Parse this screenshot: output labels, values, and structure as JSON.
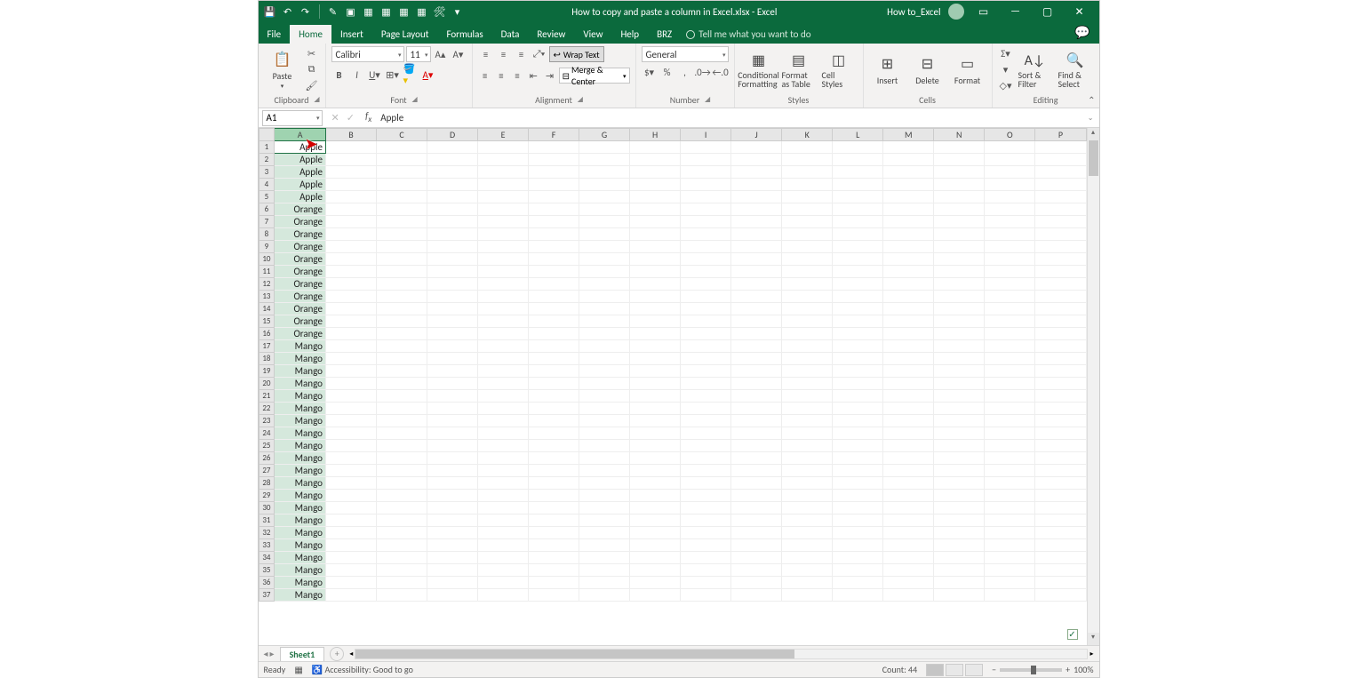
{
  "title": "How to copy and paste a column in Excel.xlsx - Excel",
  "user": "How to_Excel",
  "tabs": [
    "File",
    "Home",
    "Insert",
    "Page Layout",
    "Formulas",
    "Data",
    "Review",
    "View",
    "Help",
    "BRZ"
  ],
  "active_tab": 1,
  "tell_me": "Tell me what you want to do",
  "font": {
    "name": "Calibri",
    "size": "11"
  },
  "groups": {
    "clipboard": "Clipboard",
    "font": "Font",
    "alignment": "Alignment",
    "number": "Number",
    "styles": "Styles",
    "cells": "Cells",
    "editing": "Editing"
  },
  "paste": "Paste",
  "wrap": "Wrap Text",
  "merge": "Merge & Center",
  "numfmt": "General",
  "cond": "Conditional Formatting",
  "fmtas": "Format as Table",
  "cellst": "Cell Styles",
  "ins": "Insert",
  "del": "Delete",
  "fmt": "Format",
  "sort": "Sort & Filter",
  "find": "Find & Select",
  "namebox": "A1",
  "formula": "Apple",
  "cols": [
    "A",
    "B",
    "C",
    "D",
    "E",
    "F",
    "G",
    "H",
    "I",
    "J",
    "K",
    "L",
    "M",
    "N",
    "O",
    "P"
  ],
  "colA_data": [
    "Apple",
    "Apple",
    "Apple",
    "Apple",
    "Apple",
    "Orange",
    "Orange",
    "Orange",
    "Orange",
    "Orange",
    "Orange",
    "Orange",
    "Orange",
    "Orange",
    "Orange",
    "Orange",
    "Mango",
    "Mango",
    "Mango",
    "Mango",
    "Mango",
    "Mango",
    "Mango",
    "Mango",
    "Mango",
    "Mango",
    "Mango",
    "Mango",
    "Mango",
    "Mango",
    "Mango",
    "Mango",
    "Mango",
    "Mango",
    "Mango",
    "Mango",
    "Mango"
  ],
  "sheet_tab": "Sheet1",
  "status": {
    "ready": "Ready",
    "acc": "Accessibility: Good to go",
    "count": "Count: 44",
    "zoom": "100%"
  }
}
